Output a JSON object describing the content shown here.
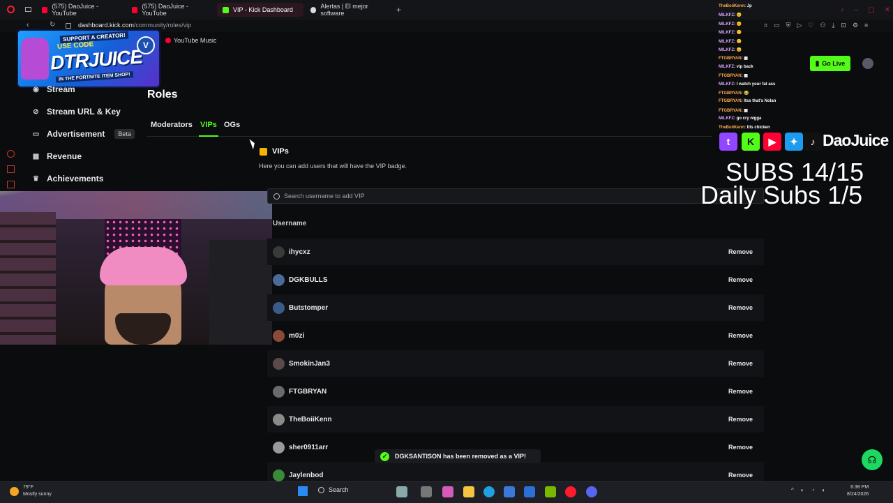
{
  "browser": {
    "tabs": [
      {
        "label": "(575) DaoJuice - YouTube",
        "color": "#ff0033"
      },
      {
        "label": "(575) DaoJuice - YouTube",
        "color": "#ff0033"
      },
      {
        "label": "VIP - Kick Dashboard",
        "color": "#53fc18"
      },
      {
        "label": "Alertas | El mejor software",
        "color": "#dcdcdc"
      }
    ],
    "new_tab": "+",
    "address_host": "dashboard.kick.com",
    "address_path": "/community/roles/vip",
    "bookmark": "YouTube Music"
  },
  "promo": {
    "line1": "SUPPORT A CREATOR!",
    "line2": "USE CODE",
    "line3": "DTRJUICE",
    "line4": "IN THE FORTNITE ITEM SHOP!"
  },
  "nav": {
    "items": [
      {
        "label": "Stream",
        "icon": "stream-icon"
      },
      {
        "label": "Stream URL & Key",
        "icon": "link-icon"
      },
      {
        "label": "Advertisement",
        "icon": "ad-icon",
        "badge": "Beta"
      },
      {
        "label": "Revenue",
        "icon": "revenue-icon"
      },
      {
        "label": "Achievements",
        "icon": "trophy-icon"
      }
    ]
  },
  "main": {
    "title": "Roles",
    "tabs": [
      "Moderators",
      "VIPs",
      "OGs"
    ],
    "active_tab": "VIPs",
    "section_title": "VIPs",
    "section_desc": "Here you can add users that will have the VIP badge.",
    "search_placeholder": "Search username to add VIP",
    "column_header": "Username",
    "remove_label": "Remove",
    "users": [
      {
        "name": "ihycxz",
        "avatar_color": "#3a3a3a"
      },
      {
        "name": "DGKBULLS",
        "avatar_color": "#4a6a9a"
      },
      {
        "name": "Butstomper",
        "avatar_color": "#3a5a8a"
      },
      {
        "name": "m0zi",
        "avatar_color": "#8a4a3a"
      },
      {
        "name": "SmokinJan3",
        "avatar_color": "#5a4a4a"
      },
      {
        "name": "FTGBRYAN",
        "avatar_color": "#6a6a6a"
      },
      {
        "name": "TheBoiiKenn",
        "avatar_color": "#8a8a8a"
      },
      {
        "name": "sher0911arr",
        "avatar_color": "#9a9a9a"
      },
      {
        "name": "Jaylenbod",
        "avatar_color": "#3a8a3a"
      }
    ]
  },
  "toast": {
    "message": "DGKSANTISON has been removed as a VIP!",
    "accent": "#53fc18"
  },
  "header": {
    "go_live": "Go Live"
  },
  "chat": [
    {
      "user": "TheBoiiKenn",
      "text": ": Jp",
      "color": "o"
    },
    {
      "user": "MILKFZ",
      "text": ": 😊",
      "color": "g"
    },
    {
      "user": "MILKFZ",
      "text": ": 😊",
      "color": "g"
    },
    {
      "user": "MILKFZ",
      "text": ": 😊",
      "color": "g"
    },
    {
      "user": "MILKFZ",
      "text": ": 😊",
      "color": "g"
    },
    {
      "user": "MILKFZ",
      "text": ": 😊",
      "color": "g"
    },
    {
      "user": "FTGBRYAN",
      "text": ": ▦",
      "color": "o"
    },
    {
      "user": "MILKFZ",
      "text": ": vip back",
      "color": "g"
    },
    {
      "user": "FTGBRYAN",
      "text": ": ▦",
      "color": "o"
    },
    {
      "user": "MILKFZ",
      "text": ": I watch your fat ass",
      "color": "g"
    },
    {
      "user": "FTGBRYAN",
      "text": ": 😂",
      "color": "o"
    },
    {
      "user": "FTGBRYAN",
      "text": ": Itss that's Nolan",
      "color": "o"
    },
    {
      "user": "FTGBRYAN",
      "text": ": ▦",
      "color": "o"
    },
    {
      "user": "MILKFZ",
      "text": ": go cry nigga",
      "color": "g"
    },
    {
      "user": "TheBoiiKenn",
      "text": ": Itts chicken",
      "color": "o"
    }
  ],
  "overlay": {
    "handle": "DaoJuice",
    "subs_line": "SUBS 14/15",
    "daily_line": "Daily Subs  1/5"
  },
  "taskbar": {
    "weather_temp": "79°F",
    "weather_desc": "Mostly sunny",
    "search_label": "Search",
    "time": "6:38 PM",
    "date": "8/24/2026"
  }
}
